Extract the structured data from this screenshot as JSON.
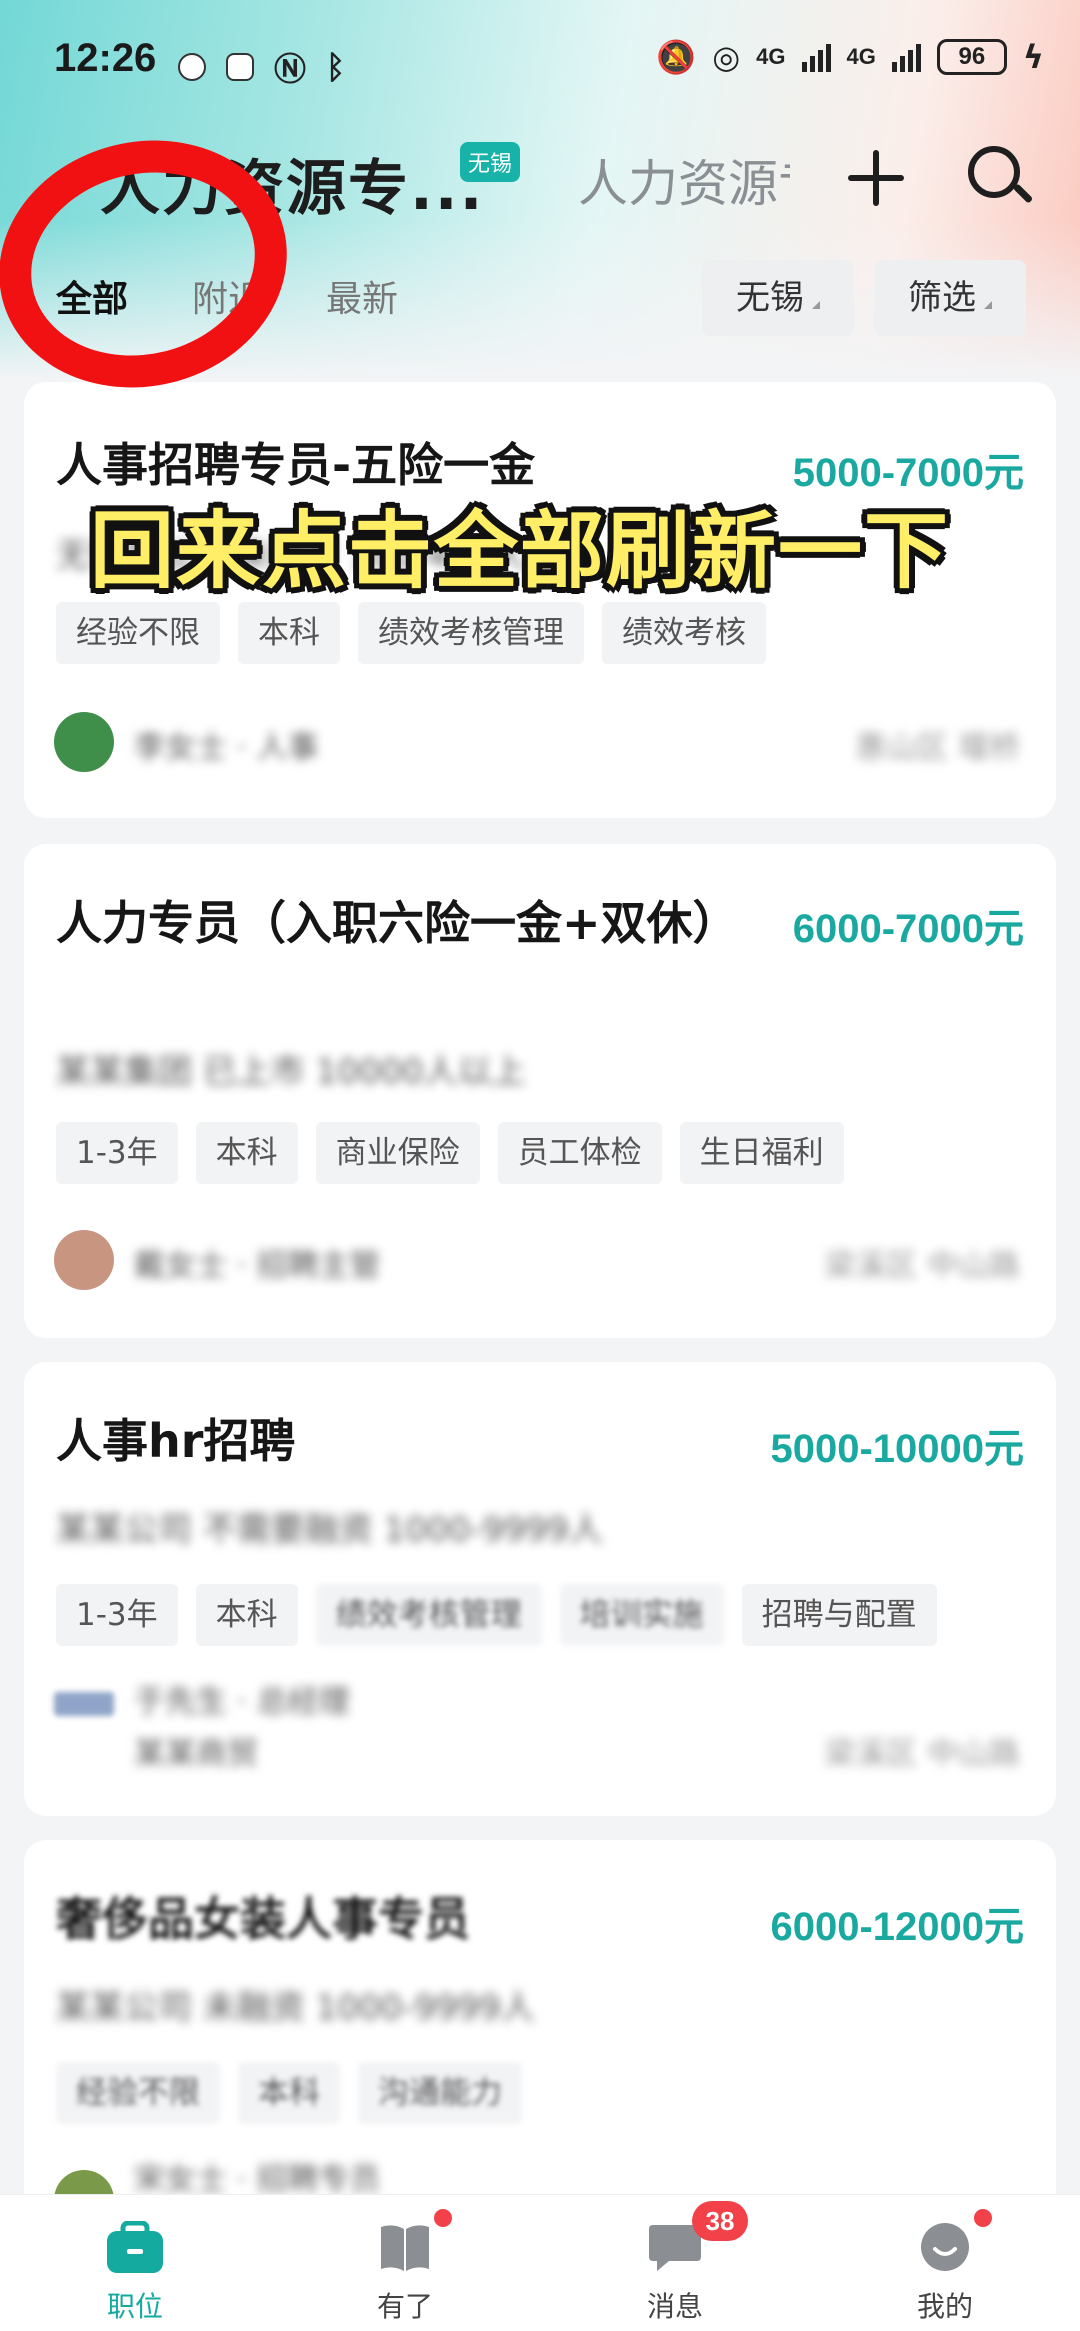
{
  "status_bar": {
    "time": "12:26",
    "network_1": "4G",
    "network_2": "4G",
    "battery": "96"
  },
  "header": {
    "title": "人力资源专...",
    "city_badge": "无锡",
    "second_title": "人力资源专员",
    "icons": {
      "add": "plus-icon",
      "search": "search-icon"
    }
  },
  "tabs": [
    {
      "label": "全部",
      "active": true
    },
    {
      "label": "附近",
      "active": false
    },
    {
      "label": "最新",
      "active": false
    }
  ],
  "filters": {
    "city": "无锡",
    "filter": "筛选"
  },
  "overlay_caption": "回来点击全部刷新一下",
  "jobs": [
    {
      "title": "人事招聘专员-五险一金",
      "salary": "5000-7000元",
      "company": "无锡某公司 未融资 100-499人",
      "tags": [
        "经验不限",
        "本科",
        "绩效考核管理",
        "绩效考核"
      ],
      "recruiter": "李女士 · 人事",
      "location": "惠山区 堰桥",
      "avatar_color": "#3f8e4a"
    },
    {
      "title": "人力专员（入职六险一金+双休）",
      "salary": "6000-7000元",
      "company": "某某集团 已上市 10000人以上",
      "tags": [
        "1-3年",
        "本科",
        "商业保险",
        "员工体检",
        "生日福利"
      ],
      "recruiter": "戴女士 · 招聘主管",
      "location": "梁溪区 中山路",
      "avatar_color": "#c89580"
    },
    {
      "title": "人事hr招聘",
      "salary": "5000-10000元",
      "company": "某某公司 不需要融资 1000-9999人",
      "tags": [
        "1-3年",
        "本科",
        "绩效考核管理",
        "培训实施",
        "招聘与配置"
      ],
      "recruiter": "于先生 · 总经理",
      "recruiter_sub": "某某商贸",
      "location": "梁溪区 中山路",
      "avatar_color": "#8fa4c8"
    },
    {
      "title": "奢侈品女装人事专员",
      "salary": "6000-12000元",
      "company": "某某公司 未融资 1000-9999人",
      "tags": [
        "经验不限",
        "本科",
        "沟通能力"
      ],
      "recruiter": "宋女士 · 招聘专员",
      "avatar_color": "#7a9a4a"
    }
  ],
  "bottom_nav": [
    {
      "label": "职位",
      "icon": "briefcase-icon",
      "active": true
    },
    {
      "label": "有了",
      "icon": "book-icon",
      "dot": true
    },
    {
      "label": "消息",
      "icon": "chat-icon",
      "badge": "38"
    },
    {
      "label": "我的",
      "icon": "smile-icon",
      "dot": true
    }
  ],
  "colors": {
    "accent": "#15aa9f",
    "salary": "#1aa9a0",
    "badge": "#f3414a",
    "annotation": "#f21112",
    "caption": "#ffee66"
  }
}
